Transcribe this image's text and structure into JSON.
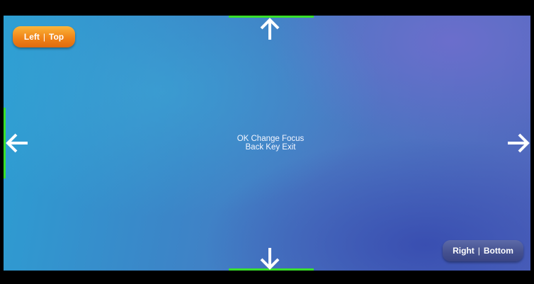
{
  "screen": {
    "focus_edges": [
      "top",
      "left",
      "bottom"
    ]
  },
  "buttons": {
    "left_top": {
      "part1": "Left",
      "separator": "|",
      "part2": "Top",
      "color": "#f08418"
    },
    "right_bottom": {
      "part1": "Right",
      "separator": "|",
      "part2": "Bottom",
      "color": "#44508f"
    }
  },
  "instructions": {
    "line1": "OK Change Focus",
    "line2": "Back Key Exit"
  },
  "arrows": {
    "up": "arrow-up-icon",
    "down": "arrow-down-icon",
    "left": "arrow-left-icon",
    "right": "arrow-right-icon"
  },
  "colors": {
    "focus_edge": "#39e02b",
    "background_start": "#2c9fd3",
    "background_end": "#5268be"
  }
}
